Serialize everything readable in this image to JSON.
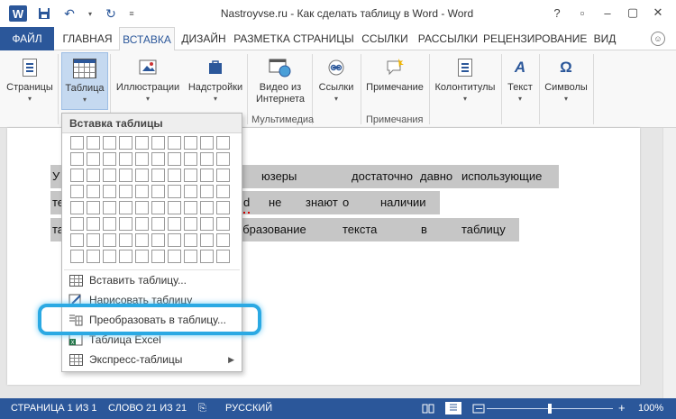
{
  "titlebar": {
    "logo_letter": "W",
    "title": "Nastroyvse.ru - Как сделать таблицу в Word - Word",
    "buttons": [
      "?",
      "▫",
      "–",
      "▢",
      "✕"
    ]
  },
  "tabs": {
    "file": "ФАЙЛ",
    "items": [
      "ГЛАВНАЯ",
      "ВСТАВКА",
      "ДИЗАЙН",
      "РАЗМЕТКА СТРАНИЦЫ",
      "ССЫЛКИ",
      "РАССЫЛКИ",
      "РЕЦЕНЗИРОВАНИЕ",
      "ВИД"
    ],
    "active": "ВСТАВКА"
  },
  "ribbon": {
    "pages": "Страницы",
    "table": "Таблица",
    "illustrations": "Иллюстрации",
    "addins": "Надстройки",
    "video_line1": "Видео из",
    "video_line2": "Интернета",
    "links": "Ссылки",
    "comment": "Примечание",
    "headers": "Колонтитулы",
    "text": "Текст",
    "symbols": "Символы",
    "group_multimedia": "Мультимедиа",
    "group_comments": "Примечания"
  },
  "document": {
    "row1": [
      "У",
      "юзеры",
      "достаточно",
      "давно",
      "использующие"
    ],
    "row2": [
      "те",
      "d",
      "не",
      "знают",
      "о",
      "наличии"
    ],
    "row3": [
      "та",
      "образование",
      "текста",
      "в",
      "таблицу"
    ]
  },
  "dropdown": {
    "header": "Вставка таблицы",
    "grid_cols": 10,
    "grid_rows": 8,
    "items": [
      {
        "label": "Вставить таблицу...",
        "submenu": false
      },
      {
        "label": "Нарисовать таблицу",
        "submenu": false
      },
      {
        "label": "Преобразовать в таблицу...",
        "submenu": false
      },
      {
        "label": "Таблица Excel",
        "submenu": false
      },
      {
        "label": "Экспресс-таблицы",
        "submenu": true
      }
    ]
  },
  "status": {
    "page": "СТРАНИЦА 1 ИЗ 1",
    "words": "СЛОВО 21 ИЗ 21",
    "language": "РУССКИЙ",
    "zoom_minus": "–",
    "zoom_plus": "+",
    "zoom": "100%",
    "zoom_percent": 100
  },
  "colors": {
    "accent": "#2b579a",
    "highlight": "#2ba9e3",
    "selection": "#c6c6c6"
  }
}
